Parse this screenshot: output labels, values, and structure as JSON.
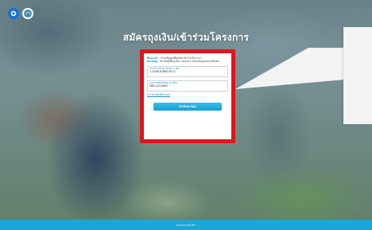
{
  "header": {
    "title": "สมัครถุงเงิน/เข้าร่วมโครงการ",
    "logos": [
      "bank-logo",
      "government-logo"
    ]
  },
  "form": {
    "note_1_label": "ข้อแนะนำ:",
    "note_1_text": "กรอกข้อมูลเพื่อสมัครเข้าร่วมโครงการ",
    "note_2_label": "หมายเหตุ:",
    "note_2_text": "ตั้งรหัสผู้ใช้ต่อเนื่อง กรุณาตรวจสอบข้อมูลก่อนกดยืนยัน",
    "id_field_label": "เลขประจำตัวประชาชน 13 หลัก",
    "id_field_value": "1-2345-67890-87-0",
    "phone_field_label": "เบอร์โทรศัพท์มือถือ (10 หลัก)",
    "phone_field_value": "089-123-4567",
    "forgot_link": "ตรวจสอบสิทธิ์ย้อนหลัง",
    "submit_label": "ดำเนินการต่อ"
  },
  "footer": {
    "text": "ธนาคารกรุงไทย"
  },
  "colors": {
    "highlight": "#e1141b",
    "accent": "#1aa6d8",
    "button": "#169fd0"
  }
}
